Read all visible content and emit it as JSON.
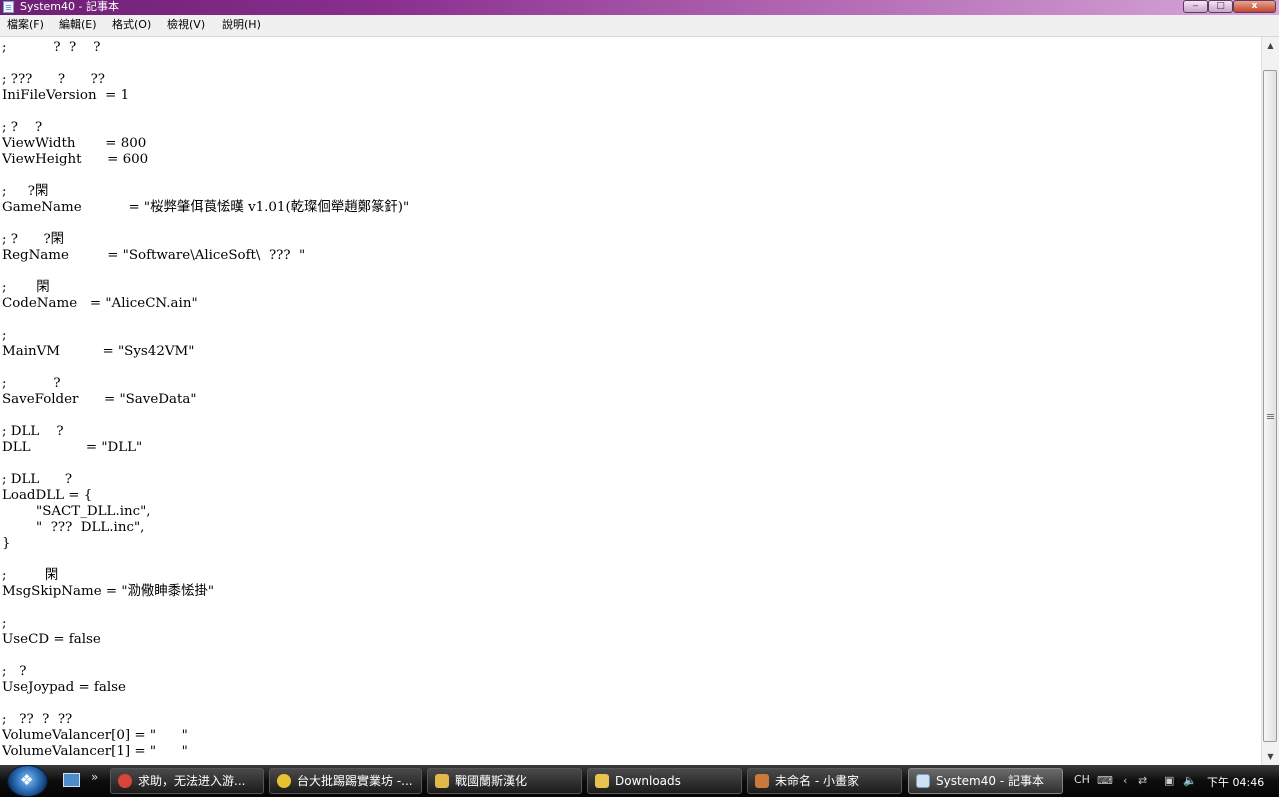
{
  "window": {
    "title": "System40 - 記事本",
    "min_glyph": "‒",
    "max_glyph": "□",
    "close_glyph": "x"
  },
  "menu": [
    "檔案(F)",
    "編輯(E)",
    "格式(O)",
    "檢視(V)",
    "說明(H)"
  ],
  "editor": {
    "text": ";           ?  ?    ?\n\n; ???      ?      ??\nIniFileVersion  = 1\n\n; ?    ?\nViewWidth       = 800\nViewHeight      = 600\n\n;     ?閑\nGameName           = \"桜弊肇佴莨恡暵 v1.01(乾璨佪犖趙鄭篆釬)\"\n\n; ?      ?閑\nRegName         = \"Software\\AliceSoft\\  ???  \"\n\n;       閑\nCodeName   = \"AliceCN.ain\"\n\n;\nMainVM          = \"Sys42VM\"\n\n;           ?\nSaveFolder      = \"SaveData\"\n\n; DLL    ?\nDLL             = \"DLL\"\n\n; DLL      ?\nLoadDLL = {\n        \"SACT_DLL.inc\",\n        \"  ???  DLL.inc\",\n}\n\n;         閑\nMsgSkipName = \"泐儆眒黍恡掛\"\n\n;\nUseCD = false\n\n;   ?\nUseJoypad = false\n\n;   ??  ?  ??\nVolumeValancer[0] = \"      \"\nVolumeValancer[1] = \"      \""
  },
  "taskbar": {
    "quicklaunch_more": "»",
    "tasks": [
      {
        "label": "求助，无法进入游...",
        "icon": "chrome-icon",
        "color": "#d9443a"
      },
      {
        "label": "台大批踢踢實業坊 -...",
        "icon": "search-icon",
        "color": "#e6c230"
      },
      {
        "label": "戰國蘭斯漢化",
        "icon": "folder-icon",
        "color": "#e0b94a"
      },
      {
        "label": "Downloads",
        "icon": "folder-icon",
        "color": "#e7c24f"
      },
      {
        "label": "未命名 - 小畫家",
        "icon": "paint-icon",
        "color": "#c97a3a"
      },
      {
        "label": "System40 - 記事本",
        "icon": "notepad-icon",
        "color": "#cfe0f2"
      }
    ],
    "tray": {
      "lang": "CH",
      "time": "下午 04:46"
    }
  }
}
